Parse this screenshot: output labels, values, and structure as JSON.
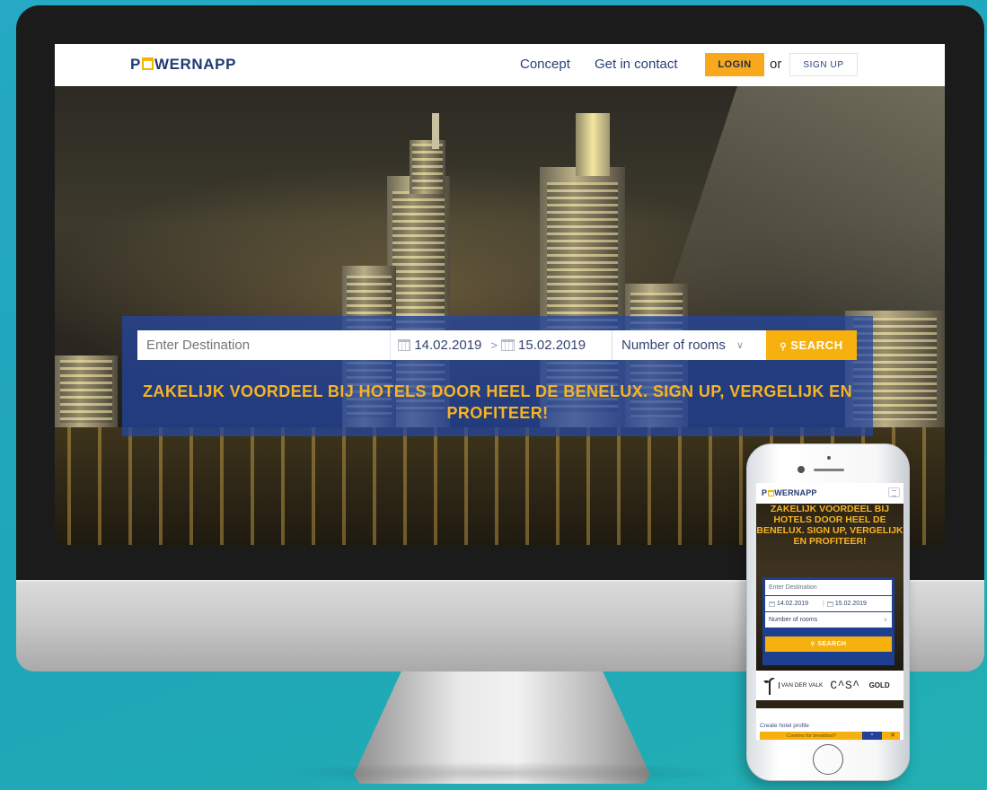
{
  "desktop": {
    "logo": {
      "left": "P",
      "right": "WERNAPP"
    },
    "nav": {
      "concept": "Concept",
      "contact": "Get in contact",
      "login": "LOGIN",
      "or": "or",
      "signup": "SIGN UP"
    },
    "search": {
      "destination_placeholder": "Enter Destination",
      "checkin": "14.02.2019",
      "checkout": "15.02.2019",
      "date_separator": ">",
      "rooms": "Number of rooms",
      "search_button": "SEARCH"
    },
    "tagline": "ZAKELIJK VOORDEEL BIJ HOTELS DOOR HEEL DE BENELUX. SIGN UP, VERGELIJK EN PROFITEER!"
  },
  "mobile": {
    "logo": {
      "left": "P",
      "right": "WERNAPP"
    },
    "tagline": "ZAKELIJK VOORDEEL BIJ HOTELS DOOR HEEL DE BENELUX. SIGN UP, VERGELIJK EN PROFITEER!",
    "search": {
      "destination_placeholder": "Enter Destination",
      "checkin": "14.02.2019",
      "checkout": "15.02.2019",
      "rooms": "Number of rooms",
      "search_button": "SEARCH"
    },
    "partners": {
      "vandervalk": "VAN DER VALK",
      "casa": "C^S^",
      "gold": "GOLD"
    },
    "create_profile": "Create hotel profile",
    "cookie_text": "Cookies for breakfast?"
  },
  "colors": {
    "background": "#25a9c4",
    "accent": "#f7b10e",
    "brand": "#1f3a74",
    "panel": "#2346a5"
  },
  "icons": [
    "search-icon",
    "calendar-icon",
    "chevron-down-icon",
    "menu-icon",
    "close-icon"
  ]
}
